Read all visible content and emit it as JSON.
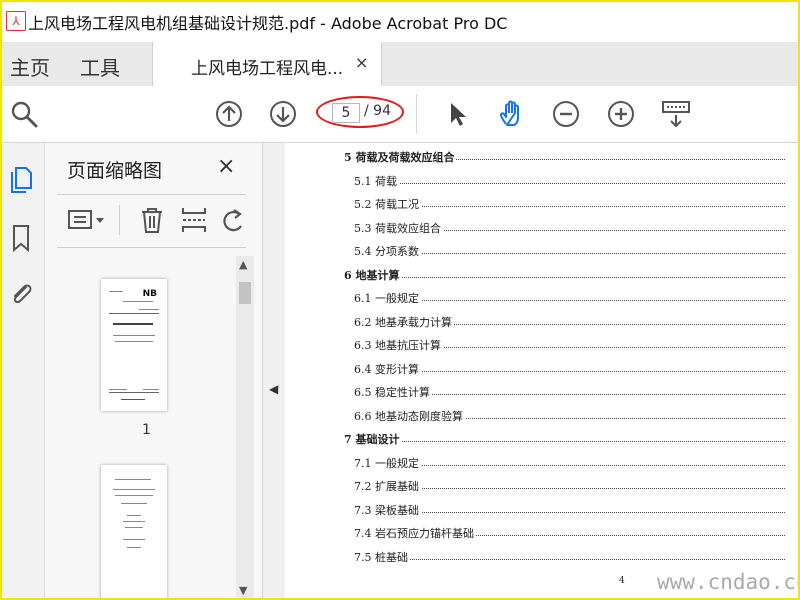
{
  "window": {
    "title": "上风电场工程风电机组基础设计规范.pdf - Adobe Acrobat Pro DC"
  },
  "tabs": {
    "home": "主页",
    "tools": "工具",
    "document": "上风电场工程风电...",
    "close": "×"
  },
  "toolbar": {
    "current_page": "5",
    "total_pages": "/ 94"
  },
  "panel": {
    "title": "页面缩略图",
    "close": "×",
    "thumbnails": [
      {
        "label": "1",
        "logo": "NB"
      },
      {
        "label": ""
      }
    ]
  },
  "toc": [
    {
      "text": "5  荷载及荷载效应组合",
      "level": 1
    },
    {
      "text": "5.1  荷载",
      "level": 2
    },
    {
      "text": "5.2  荷载工况",
      "level": 2
    },
    {
      "text": "5.3  荷载效应组合",
      "level": 2
    },
    {
      "text": "5.4  分项系数",
      "level": 2
    },
    {
      "text": "6  地基计算",
      "level": 1
    },
    {
      "text": "6.1  一般规定",
      "level": 2
    },
    {
      "text": "6.2  地基承载力计算",
      "level": 2
    },
    {
      "text": "6.3  地基抗压计算",
      "level": 2
    },
    {
      "text": "6.4  变形计算",
      "level": 2
    },
    {
      "text": "6.5  稳定性计算",
      "level": 2
    },
    {
      "text": "6.6  地基动态刚度验算",
      "level": 2
    },
    {
      "text": "7  基础设计",
      "level": 1
    },
    {
      "text": "7.1  一般规定",
      "level": 2
    },
    {
      "text": "7.2  扩展基础",
      "level": 2
    },
    {
      "text": "7.3  梁板基础",
      "level": 2
    },
    {
      "text": "7.4  岩石预应力锚杆基础",
      "level": 2
    },
    {
      "text": "7.5  桩基础",
      "level": 2
    }
  ],
  "doc_footer": {
    "page_number": "4",
    "watermark": "www.cndao.com"
  },
  "colors": {
    "frame_border": "#f2e600",
    "highlight_ellipse": "#e01b1b",
    "active_tool_blue": "#1473e6"
  },
  "icons": {
    "search": "search-icon",
    "prev_page": "arrow-up-circle-icon",
    "next_page": "arrow-down-circle-icon",
    "select": "cursor-arrow-icon",
    "hand": "hand-icon",
    "zoom_out": "zoom-out-icon",
    "zoom_in": "zoom-in-icon",
    "keyboard": "keyboard-icon",
    "pages": "pages-icon",
    "bookmark": "bookmark-icon",
    "attachment": "paperclip-icon",
    "options": "options-menu-icon",
    "delete": "trash-icon",
    "insert": "insert-page-icon",
    "rotate": "rotate-icon"
  }
}
